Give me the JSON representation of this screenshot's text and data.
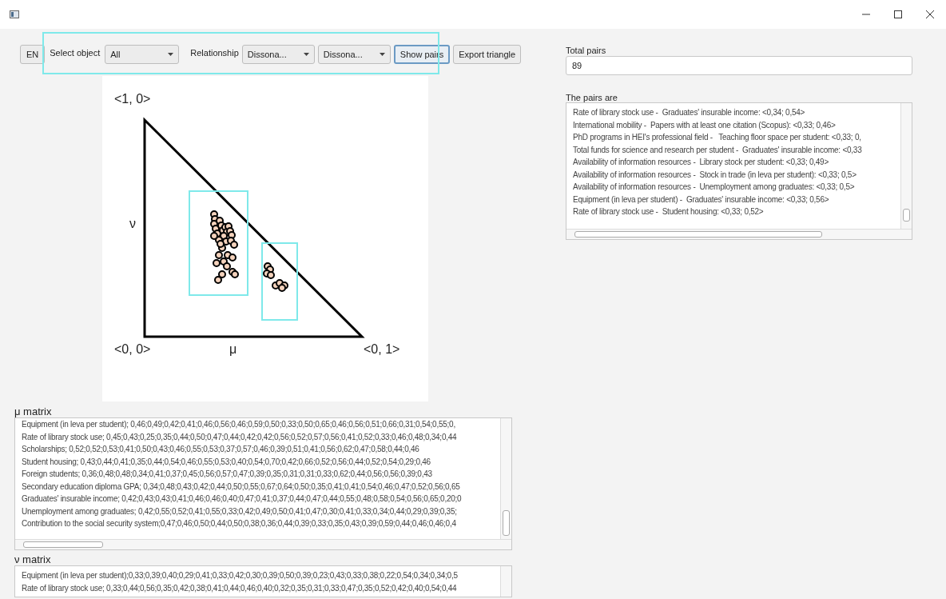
{
  "toolbar": {
    "language_button": "EN",
    "select_object": {
      "label": "Select object",
      "value": "All"
    },
    "relationship": {
      "label": "Relationship",
      "values": [
        "Dissona...",
        "Dissona..."
      ]
    },
    "buttons": [
      {
        "label": "Show pairs",
        "focused": true
      },
      {
        "label": "Export triangle",
        "focused": false
      }
    ]
  },
  "triangle_plot": {
    "top_vertex": "<1, 0>",
    "vertical_axis": "ν",
    "origin": "<0, 0>",
    "horizontal_axis": "μ",
    "right_vertex": "<0, 1>"
  },
  "mu_matrix": {
    "label": "μ matrix",
    "lines": [
      "Equipment (in leva per student); 0,46;0,49;0,42;0,41;0,46;0,56;0,46;0,59;0,50;0,33;0,50;0,65;0,46;0,56;0,51;0,66;0,31;0,54;0,55;0,",
      "Rate of library stock use; 0,45;0,43;0,25;0,35;0,44;0,50;0,47;0,44;0,42;0,42;0,56;0,52;0,57;0,56;0,41;0,52;0,33;0,46;0,48;0,34;0,44",
      "Scholarships; 0,52;0,52;0,53;0,41;0,50;0,43;0,46;0,55;0,53;0,37;0,57;0,46;0,39;0,51;0,41;0,56;0,62;0,47;0,58;0,44;0,46",
      "Student housing; 0,43;0,44;0,41;0,35;0,44;0,54;0,46;0,55;0,53;0,40;0,54;0,70;0,42;0,66;0,52;0,56;0,44;0,52;0,54;0,29;0,46",
      "Foreign students; 0,36;0,48;0,48;0,34;0,41;0,37;0,45;0,56;0,57;0,47;0,39;0,35;0,31;0,31;0,33;0,62;0,44;0,56;0,56;0,39;0,43",
      "Secondary education diploma GPA; 0,34;0,48;0,43;0,42;0,44;0,50;0,55;0,67;0,64;0,50;0,35;0,41;0,41;0,54;0,46;0,47;0,52;0,56;0,65",
      "Graduates' insurable income; 0,42;0,43;0,43;0,41;0,46;0,46;0,40;0,47;0,41;0,37;0,44;0,47;0,44;0,55;0,48;0,58;0,54;0,56;0,65;0,20;0",
      "Unemployment among graduates; 0,42;0,55;0,52;0,41;0,55;0,33;0,42;0,49;0,50;0,41;0,47;0,30;0,41;0,33;0,34;0,44;0,29;0,39;0,35;",
      "Contribution to the social security system;0,47;0,46;0,50;0,44;0,50;0,38;0,36;0,44;0,39;0,33;0,35;0,43;0,39;0,59;0,44;0,46;0,46;0,4"
    ]
  },
  "nu_matrix": {
    "label": "ν matrix",
    "lines": [
      "Equipment (in leva per student);0,33;0,39;0,40;0,29;0,41;0,33;0,42;0,30;0,39;0,50;0,39;0,23;0,43;0,33;0,38;0,22;0,54;0,34;0,34;0,5",
      "Rate of library stock use; 0,33;0,44;0,56;0,35;0,42;0,38;0,41;0,44;0,46;0,40;0,32;0,35;0,31;0,33;0,47;0,35;0,52;0,42;0,40;0,54;0,44"
    ]
  },
  "total_pairs": {
    "label": "Total pairs",
    "value": "89"
  },
  "pairs": {
    "label": "The pairs are",
    "lines": [
      "Rate of library stock use -  Graduates' insurable income: <0,34; 0,54>",
      "International mobility -  Papers with at least one citation (Scopus): <0,33; 0,46>",
      "PhD programs in HEI's professional field -   Teaching floor space per student: <0,33; 0,",
      "Total funds for science and research per student -  Graduates' insurable income: <0,33",
      "Availability of information resources -  Library stock per student: <0,33; 0,49>",
      "Availability of information resources -  Stock in trade (in leva per student): <0,33; 0,5>",
      "Availability of information resources -  Unemployment among graduates: <0,33; 0,5>",
      "Equipment (in leva per student) -  Graduates' insurable income: <0,33; 0,56>",
      "Rate of library stock use -  Student housing: <0,33; 0,52>"
    ]
  }
}
